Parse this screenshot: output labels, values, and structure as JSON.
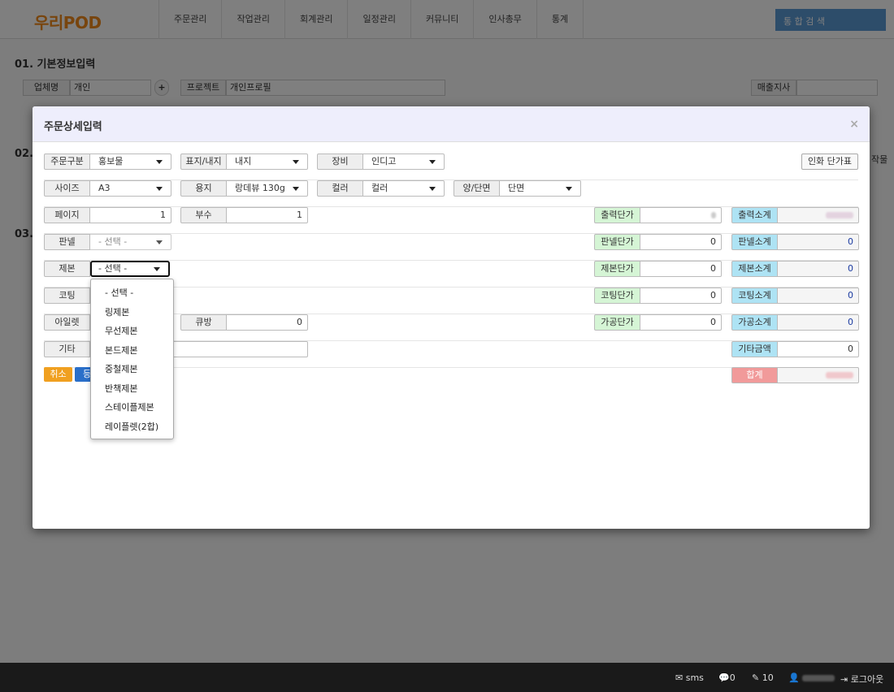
{
  "background": {
    "logo": "우리POD",
    "menu": [
      "주문관리",
      "작업관리",
      "회계관리",
      "일정관리",
      "커뮤니티",
      "인사총무",
      "통계"
    ],
    "search_label": "통 합 검 색",
    "section1_title": "01. 기본정보입력",
    "section2_title": "02.",
    "section3_title": "03.",
    "company_label": "업체명",
    "company_value": "개인",
    "project_label": "프로젝트",
    "project_value": "개인프로필",
    "branch_label": "매출지사",
    "side_text": "작물"
  },
  "footer": {
    "sms": "sms",
    "comments": "0",
    "edits": "10",
    "logout": "로그아웃"
  },
  "modal": {
    "title": "주문상세입력",
    "close": "×",
    "price_table_button": "인화 단가표",
    "order_type": {
      "label": "주문구분",
      "value": "홍보물"
    },
    "cover": {
      "label": "표지/내지",
      "value": "내지"
    },
    "equipment": {
      "label": "장비",
      "value": "인디고"
    },
    "size": {
      "label": "사이즈",
      "value": "A3"
    },
    "paper": {
      "label": "용지",
      "value": "랑데뷰 130g"
    },
    "color": {
      "label": "컬러",
      "value": "컬러"
    },
    "sides": {
      "label": "양/단면",
      "value": "단면"
    },
    "pages": {
      "label": "페이지",
      "value": "1"
    },
    "copies": {
      "label": "부수",
      "value": "1"
    },
    "panel": {
      "label": "판넬",
      "value": "- 선택 -"
    },
    "binding": {
      "label": "제본",
      "value": "- 선택 -"
    },
    "coating": {
      "label": "코팅"
    },
    "eyelet": {
      "label": "아일렛"
    },
    "cue": {
      "label": "큐방",
      "value": "0"
    },
    "etc": {
      "label": "기타"
    },
    "print_unit": {
      "label": "출력단가"
    },
    "print_subtotal": {
      "label": "출력소계"
    },
    "panel_unit": {
      "label": "판넬단가",
      "value": "0"
    },
    "panel_subtotal": {
      "label": "판넬소계",
      "value": "0"
    },
    "binding_unit": {
      "label": "제본단가",
      "value": "0"
    },
    "binding_subtotal": {
      "label": "제본소계",
      "value": "0"
    },
    "coating_unit": {
      "label": "코팅단가",
      "value": "0"
    },
    "coating_subtotal": {
      "label": "코팅소계",
      "value": "0"
    },
    "process_unit": {
      "label": "가공단가",
      "value": "0"
    },
    "process_subtotal": {
      "label": "가공소계",
      "value": "0"
    },
    "etc_amount": {
      "label": "기타금액",
      "value": "0"
    },
    "total": {
      "label": "합계"
    },
    "cancel_button": "취소",
    "register_button": "등",
    "binding_options": [
      "- 선택 -",
      "링제본",
      "무선제본",
      "본드제본",
      "중철제본",
      "반책제본",
      "스테이플제본",
      "레이플렛(2합)"
    ]
  }
}
